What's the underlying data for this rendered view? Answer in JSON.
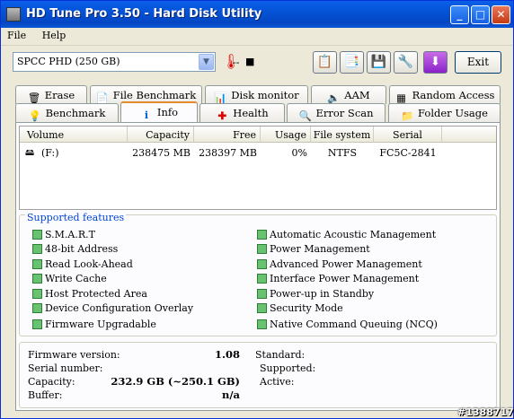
{
  "window": {
    "title": "HD Tune Pro 3.50 - Hard Disk Utility"
  },
  "menu": [
    "File",
    "Help"
  ],
  "toolbar": {
    "drive": "SPCC   PHD (250 GB)",
    "temperature": "--",
    "temp_unit_icon": "thermometer-icon",
    "exit_label": "Exit"
  },
  "tabs_top": [
    "Erase",
    "File Benchmark",
    "Disk monitor",
    "AAM",
    "Random Access"
  ],
  "tabs_bottom": [
    "Benchmark",
    "Info",
    "Health",
    "Error Scan",
    "Folder Usage"
  ],
  "active_tab": "Info",
  "volumes": {
    "headers": [
      "Volume",
      "Capacity",
      "Free",
      "Usage",
      "File system",
      "Serial"
    ],
    "rows": [
      [
        "(F:)",
        "238475 MB",
        "238397 MB",
        "0%",
        "NTFS",
        "FC5C-2841"
      ]
    ]
  },
  "features": {
    "title": "Supported features",
    "left": [
      "S.M.A.R.T",
      "48-bit Address",
      "Read Look-Ahead",
      "Write Cache",
      "Host Protected Area",
      "Device Configuration Overlay",
      "Firmware Upgradable"
    ],
    "right": [
      "Automatic Acoustic Management",
      "Power Management",
      "Advanced Power Management",
      "Interface Power Management",
      "Power-up in Standby",
      "Security Mode",
      "Native Command Queuing (NCQ)"
    ]
  },
  "info": {
    "firmware_label": "Firmware version:",
    "firmware_value": "1.08",
    "serial_label": "Serial number:",
    "serial_value": "",
    "capacity_label": "Capacity:",
    "capacity_value": "232.9 GB (~250.1 GB)",
    "buffer_label": "Buffer:",
    "buffer_value": "n/a",
    "standard_label": "Standard:",
    "supported_label": "Supported:",
    "active_label": "Active:"
  },
  "watermark": "#1388717"
}
